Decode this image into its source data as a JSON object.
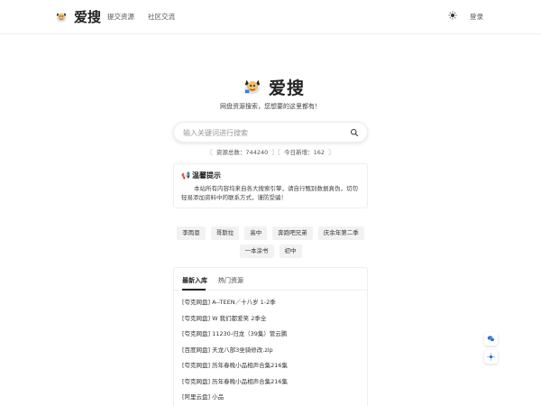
{
  "header": {
    "brand": "爱搜",
    "nav": [
      "提交资源",
      "社区交流"
    ],
    "theme_icon": "sun-icon",
    "login": "登录"
  },
  "hero": {
    "title": "爱搜",
    "subtitle": "网盘资源搜索，您想要的这里都有！"
  },
  "search": {
    "placeholder": "输入关键词进行搜索"
  },
  "stats": {
    "total_label": "资源总数：744240",
    "today_label": "今日新增：162"
  },
  "notice": {
    "title": "温馨提示",
    "body": "本站所有内容均来自各大搜索引擎，请自行甄别数据真伪，切勿轻易添加资料中的联系方式，谨防受骗！"
  },
  "tags": {
    "row1": [
      "李雨恩",
      "哥斯拉",
      "高中",
      "奔跑吧兄弟",
      "庆余年第二季"
    ],
    "row2": [
      "一本涂书",
      "初中"
    ]
  },
  "panel": {
    "tabs": [
      "最新入库",
      "热门资源"
    ],
    "items": [
      "[夸克网盘] A--TEEN／十八岁 1-2季",
      "[夸克网盘] W 我们都爱笑 2季全",
      "[夸克网盘] 11230-归龙（39集）管云鹏",
      "[百度网盘] 天龙八部3坐骑修改.zip",
      "[夸克网盘] 历年春晚小品相声合集216集",
      "[夸克网盘] 历年春晚小品相声合集216集",
      "[阿里云盘] 小品"
    ]
  },
  "float": {
    "chat_icon": "chat-icon",
    "theme_icon": "sun-icon"
  },
  "colors": {
    "accent": "#2f6fd8",
    "tag_bg": "#f2f2f2"
  }
}
